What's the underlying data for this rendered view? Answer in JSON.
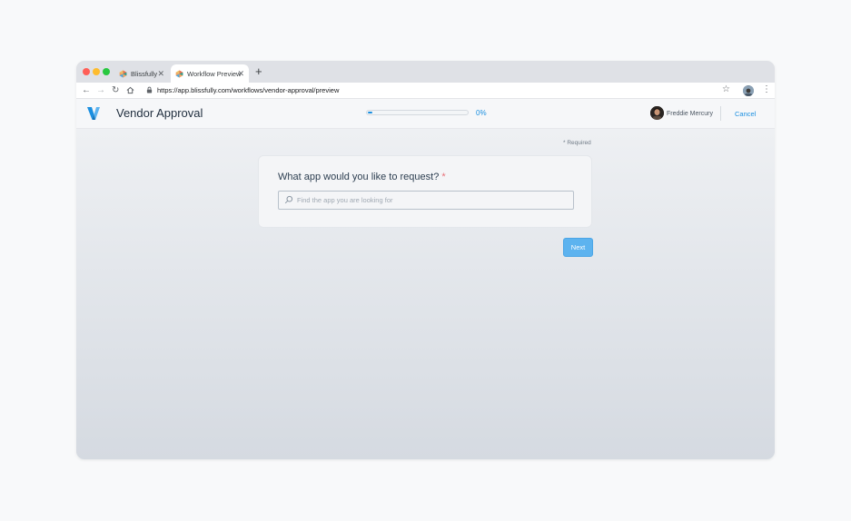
{
  "browser": {
    "tabs": [
      {
        "title": "Blissfully",
        "active": false
      },
      {
        "title": "Workflow Preview",
        "active": true
      }
    ],
    "url": "https://app.blissfully.com/workflows/vendor-approval/preview"
  },
  "header": {
    "title": "Vendor Approval",
    "progress_percent": 0,
    "progress_label": "0%",
    "user_name": "Freddie Mercury",
    "cancel_label": "Cancel"
  },
  "form": {
    "required_note": "* Required",
    "question": "What app would you like to request?",
    "required_marker": "*",
    "search_placeholder": "Find the app you are looking for",
    "search_value": "",
    "next_label": "Next"
  },
  "colors": {
    "accent": "#1b8fe0",
    "next_button": "#5db3ef",
    "required_marker": "#e8727a",
    "title_text": "#1f2d3d"
  },
  "icons": [
    "close-icon",
    "plus-icon",
    "back-arrow-icon",
    "forward-arrow-icon",
    "reload-icon",
    "home-icon",
    "lock-icon",
    "star-icon",
    "kebab-menu-icon",
    "search-icon"
  ]
}
